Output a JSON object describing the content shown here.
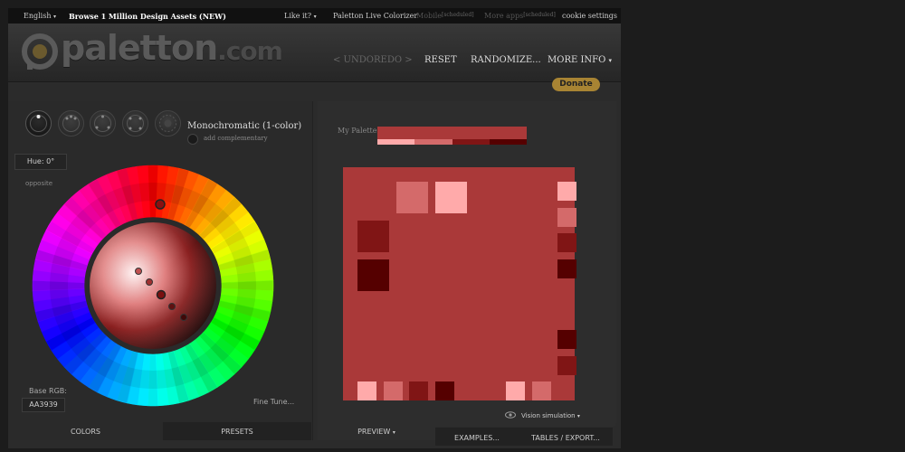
{
  "topbar": {
    "language": "English",
    "language_caret": "▾",
    "browse": "Browse 1 Million Design Assets (NEW)",
    "like": "Like it?",
    "like_caret": "▾",
    "live_colorizer": "Paletton Live Colorizer",
    "mobile": "Mobile",
    "mobile_tag": "[scheduled]",
    "more_apps": "More apps",
    "more_apps_tag": "[scheduled]",
    "cookie": "cookie settings"
  },
  "header": {
    "logo_text": "paletton",
    "logo_suffix": ".com",
    "undo": "< UNDO",
    "redo": "REDO >",
    "reset": "RESET",
    "randomize": "RANDOMIZE...",
    "more_info": "MORE INFO",
    "more_info_caret": "▾"
  },
  "donate": "Donate",
  "scheme": {
    "title": "Monochromatic (1-color)",
    "add_complementary": "add complementary"
  },
  "hue": {
    "value": "Hue: 0°",
    "opposite": "opposite"
  },
  "base_rgb": {
    "label": "Base RGB:",
    "value": "AA3939"
  },
  "fine_tune": "Fine Tune...",
  "left_tabs": {
    "colors": "COLORS",
    "presets": "PRESETS"
  },
  "right_tabs": {
    "preview": "PREVIEW",
    "preview_caret": "▾",
    "examples": "EXAMPLES...",
    "tables": "TABLES / EXPORT..."
  },
  "my_palette_label": "My Palette",
  "palette": {
    "base": "#AA3939",
    "shades": [
      "#FFAAAA",
      "#D46A6A",
      "#801515",
      "#550000"
    ]
  },
  "vision_simulation": "Vision simulation",
  "vision_caret": "▾"
}
